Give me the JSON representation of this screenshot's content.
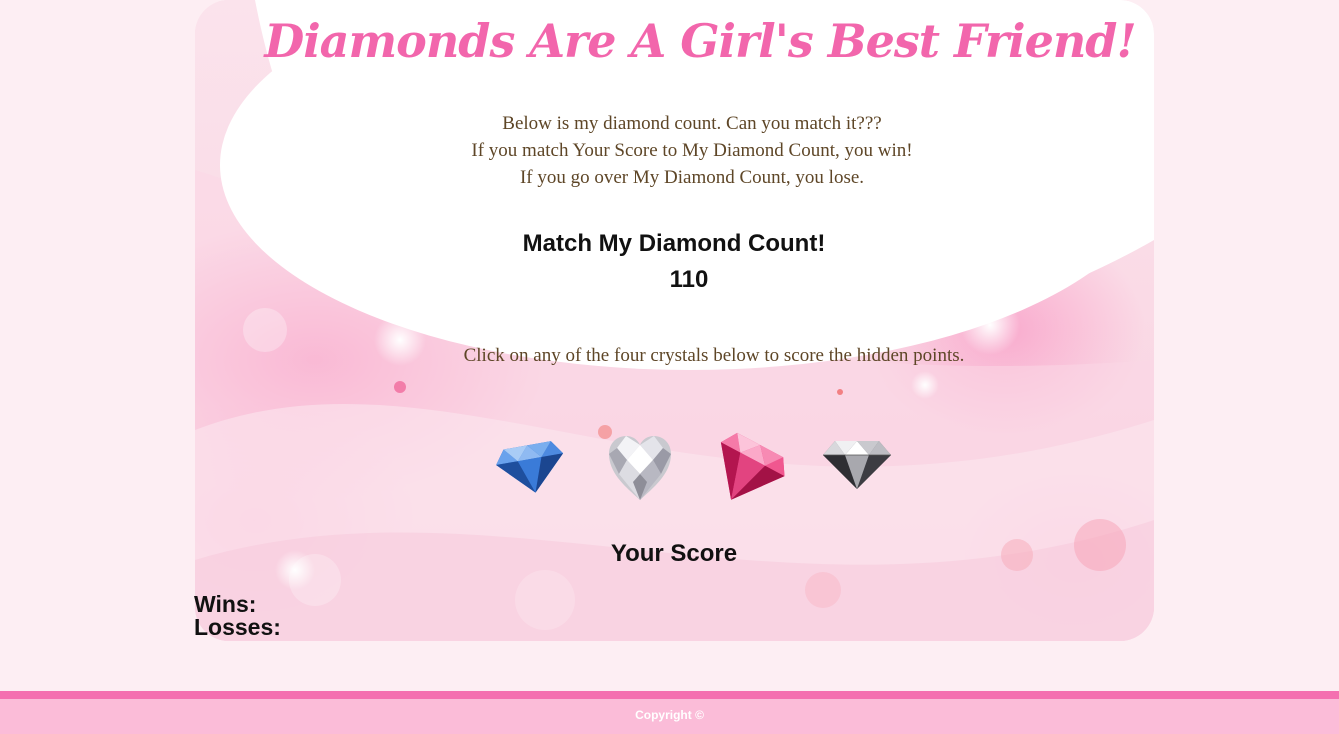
{
  "header": {
    "title": "Diamonds Are A Girl's Best Friend!"
  },
  "intro": {
    "line1": "Below is my diamond count. Can you match it???",
    "line2": "If you match Your Score to My Diamond Count, you win!",
    "line3": "If you go over My Diamond Count, you lose."
  },
  "target": {
    "label": "Match My Diamond Count!",
    "value": "110"
  },
  "instruction": "Click on any of the four crystals below to score the hidden points.",
  "crystals": [
    {
      "name": "blue-diamond",
      "color": "#2f6fd0"
    },
    {
      "name": "white-heart-diamond",
      "color": "#e6e6ea"
    },
    {
      "name": "pink-diamond",
      "color": "#e8317a"
    },
    {
      "name": "clear-diamond",
      "color": "#9a9a9a"
    }
  ],
  "score": {
    "label": "Your Score",
    "value": ""
  },
  "stats": {
    "wins_label": "Wins:",
    "wins_value": "",
    "losses_label": "Losses:",
    "losses_value": ""
  },
  "footer": {
    "copyright": "Copyright ©"
  },
  "colors": {
    "page_background": "#fdeef3",
    "title": "#f266ac",
    "body_text": "#5e4627",
    "footer_background": "#fbbcd8",
    "footer_border": "#f470b0"
  }
}
